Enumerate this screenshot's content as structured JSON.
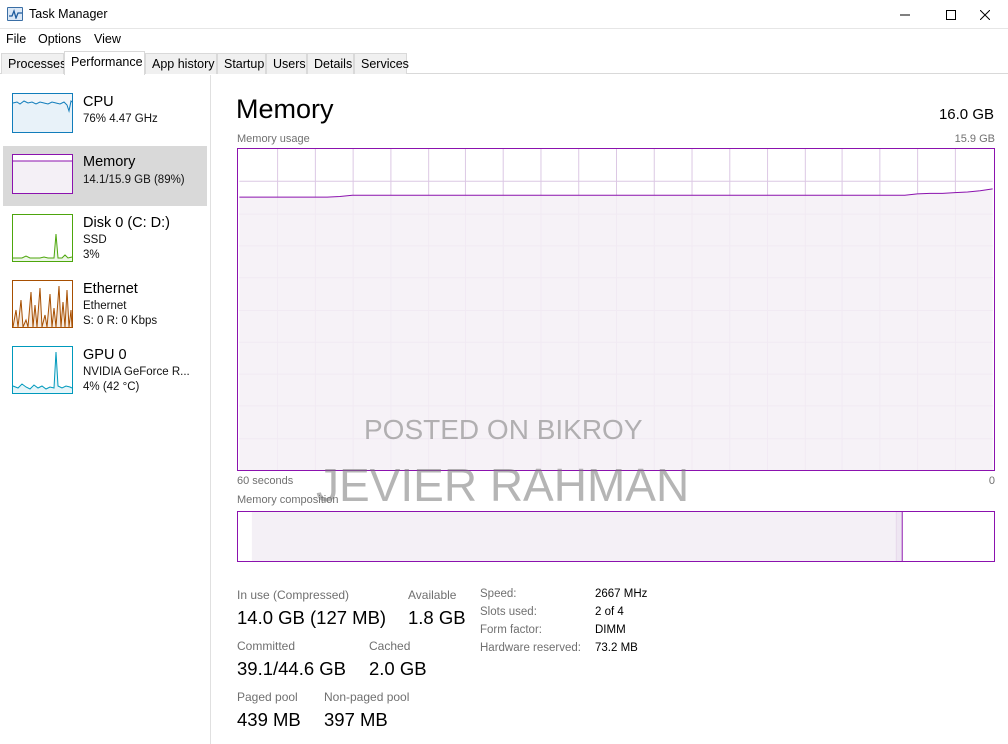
{
  "window": {
    "title": "Task Manager"
  },
  "menu": [
    "File",
    "Options",
    "View"
  ],
  "tabs": [
    "Processes",
    "Performance",
    "App history",
    "Startup",
    "Users",
    "Details",
    "Services"
  ],
  "sidebar": [
    {
      "title": "CPU",
      "line1": "76%  4.47 GHz",
      "line2": "",
      "color": "#117dbb"
    },
    {
      "title": "Memory",
      "line1": "14.1/15.9 GB (89%)",
      "line2": "",
      "color": "#8b12ae"
    },
    {
      "title": "Disk 0 (C: D:)",
      "line1": "SSD",
      "line2": "3%",
      "color": "#4da60c"
    },
    {
      "title": "Ethernet",
      "line1": "Ethernet",
      "line2": "S: 0  R: 0 Kbps",
      "color": "#a74f01"
    },
    {
      "title": "GPU 0",
      "line1": "NVIDIA GeForce R...",
      "line2": "4%  (42 °C)",
      "color": "#0099bc"
    }
  ],
  "main": {
    "title": "Memory",
    "total": "16.0 GB",
    "usage_label": "Memory usage",
    "usage_max": "15.9 GB",
    "time_label": "60 seconds",
    "time_end": "0",
    "composition_label": "Memory composition"
  },
  "stats": {
    "in_use_label": "In use (Compressed)",
    "in_use_value": "14.0 GB (127 MB)",
    "available_label": "Available",
    "available_value": "1.8 GB",
    "committed_label": "Committed",
    "committed_value": "39.1/44.6 GB",
    "cached_label": "Cached",
    "cached_value": "2.0 GB",
    "paged_label": "Paged pool",
    "paged_value": "439 MB",
    "nonpaged_label": "Non-paged pool",
    "nonpaged_value": "397 MB"
  },
  "info": {
    "speed_label": "Speed:",
    "speed_value": "2667 MHz",
    "slots_label": "Slots used:",
    "slots_value": "2 of 4",
    "form_label": "Form factor:",
    "form_value": "DIMM",
    "reserved_label": "Hardware reserved:",
    "reserved_value": "73.2 MB"
  },
  "watermark": {
    "line1": "POSTED ON BIKROY",
    "line2": "JEVIER RAHMAN"
  },
  "colors": {
    "memory": "#8b12ae",
    "memory_fill": "#f4f0f6",
    "grid": "#dcc8e4"
  },
  "graph": {
    "usage_percent_series": [
      85,
      85,
      85,
      85,
      85,
      85,
      85,
      85,
      85.2,
      85.6,
      85.6,
      85.6,
      85.6,
      85.6,
      85.6,
      85.6,
      85.6,
      85.6,
      85.6,
      85.6,
      85.6,
      85.6,
      85.6,
      85.6,
      85.6,
      85.6,
      85.6,
      85.6,
      85.6,
      85.6,
      85.6,
      85.6,
      85.6,
      85.6,
      85.6,
      85.6,
      85.6,
      85.6,
      85.6,
      85.6,
      85.6,
      85.6,
      85.6,
      85.6,
      85.6,
      85.6,
      85.6,
      85.6,
      85.6,
      85.6,
      85.6,
      85.6,
      85.6,
      85.6,
      86,
      86.2,
      86.2,
      86.4,
      86.6,
      87,
      87.6
    ],
    "composition": {
      "in_use_fraction": 0.885,
      "modified_fraction": 0.008
    }
  }
}
